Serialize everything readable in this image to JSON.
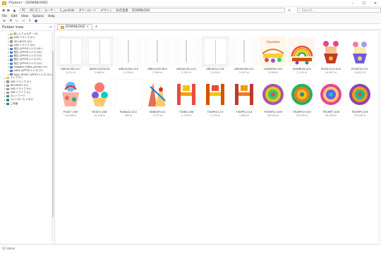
{
  "window": {
    "title": "XYplorer - [DOWNLOAD]",
    "buttons": [
      "–",
      "☐",
      "✕"
    ]
  },
  "address": {
    "segments": [
      "PC",
      "OS (C:)",
      "ユーザー",
      "k_yoshida",
      "ダウンロード",
      "デザイン",
      "虹色背景",
      "DOWNLOAD"
    ],
    "search_placeholder": "Search..."
  },
  "menu": [
    "File",
    "Edit",
    "View",
    "Options",
    "Help"
  ],
  "toolbar": {
    "icons": [
      "favorites-icon",
      "filter-icon",
      "back-icon",
      "forward-icon",
      "up-icon",
      "tag-icon"
    ]
  },
  "sidebar": {
    "header": "Folder tree",
    "items": [
      {
        "label": "新しいフォルダー (3)",
        "icon": "folder",
        "indent": 2
      },
      {
        "label": "USB ドライブ (E:)",
        "icon": "drive",
        "indent": 2
      },
      {
        "label": "HD-LBVU3 (G:)",
        "icon": "drive",
        "indent": 2
      },
      {
        "label": "USB ドライブ (H:)",
        "icon": "drive",
        "indent": 2
      },
      {
        "label": "他社 (\\\\PFX5-1.1-3) (M:)",
        "icon": "net",
        "indent": 2
      },
      {
        "label": "他社 (\\\\PFX5-1.1-3) (N:)",
        "icon": "net",
        "indent": 2
      },
      {
        "label": "他社 (\\\\PFX5-1.1-3) (O:)",
        "icon": "net",
        "indent": 2
      },
      {
        "label": "他社 (\\\\PFX5-1.1-3) (P:)",
        "icon": "net",
        "indent": 2
      },
      {
        "label": "他社 (\\\\PFX5-1.1-3) (Q:)",
        "icon": "net",
        "indent": 2
      },
      {
        "label": "Seagate (\\\\files_server) (S:)",
        "icon": "net",
        "indent": 2
      },
      {
        "label": "sdbiz (\\\\PFX5-1.1-3) (T:)",
        "icon": "net",
        "indent": 2
      },
      {
        "label": "Tools_RFIDS (\\\\PFX5-1.1-3) (U:)",
        "icon": "net",
        "indent": 2
      },
      {
        "label": "ライブラリ",
        "icon": "folder",
        "indent": 1
      },
      {
        "label": "USB ドライブ (E:)",
        "icon": "drive",
        "indent": 1
      },
      {
        "label": "HD-LBVU3 (G:)",
        "icon": "drive",
        "indent": 1
      },
      {
        "label": "USB ドライブ (H:)",
        "icon": "drive",
        "indent": 1
      },
      {
        "label": "USB ドライブ (J:)",
        "icon": "drive",
        "indent": 1
      },
      {
        "label": "ネットワーク",
        "icon": "net",
        "indent": 1
      },
      {
        "label": "コントロール パネル",
        "icon": "green",
        "indent": 1
      },
      {
        "label": "ごみ箱",
        "icon": "blue",
        "indent": 1
      }
    ]
  },
  "tabs": [
    {
      "label": "DOWNLOAD"
    }
  ],
  "files": [
    {
      "name": "AREA0300.U17",
      "size": "2,211 kl",
      "thumb": "blank"
    },
    {
      "name": "AREA12001018",
      "size": "2,080 kl",
      "thumb": "blank"
    },
    {
      "name": "AREA1000.U19",
      "size": "2,156 kl",
      "thumb": "vertical"
    },
    {
      "name": "AREA1000.B22",
      "size": "2,289 kl",
      "thumb": "vertical"
    },
    {
      "name": "AREA0100.U15",
      "size": "1,151 kl",
      "thumb": "vertical"
    },
    {
      "name": "AREA010.U16",
      "size": "1,105 kl",
      "thumb": "blank"
    },
    {
      "name": "AREA0000.U21",
      "size": "1,997 kl",
      "thumb": "vertical"
    },
    {
      "name": "GARDEN0.U01",
      "size": "5,096 kl",
      "thumb": "garden"
    },
    {
      "name": "RAINBOW.U02",
      "size": "2,120 kl",
      "thumb": "rainbow"
    },
    {
      "name": "ROSE1213.U10",
      "size": "14,992 kl",
      "thumb": "rose"
    },
    {
      "name": "ROSE3S.U11",
      "size": "14,821 kl",
      "thumb": "rose2"
    },
    {
      "name": "POSE7.U09",
      "size": "14,906 kl",
      "thumb": "pose"
    },
    {
      "name": "ROSE5.U08",
      "size": "14,418 kl",
      "thumb": "rose3"
    },
    {
      "name": "RUBAG2.U22",
      "size": "263 kl",
      "thumb": "blankwhite"
    },
    {
      "name": "3DBVDP.U12",
      "size": "1,573 kl",
      "thumb": "bvdp"
    },
    {
      "name": "T3DBS.U08",
      "size": "1,153 kl",
      "thumb": "h1"
    },
    {
      "name": "T3DPR3.U13",
      "size": "1,750 kl",
      "thumb": "h2"
    },
    {
      "name": "T3DPR2.U14",
      "size": "1,894 kl",
      "thumb": "h3"
    },
    {
      "name": "TRUMP12.U09",
      "size": "29,005 kl",
      "thumb": "trump1"
    },
    {
      "name": "TRUMP1H.U07",
      "size": "29,005 kl",
      "thumb": "trump2"
    },
    {
      "name": "TRUMP7.U08",
      "size": "29,005 kl",
      "thumb": "trump3"
    },
    {
      "name": "TRUMP5.U05",
      "size": "29,005 kl",
      "thumb": "trump4"
    }
  ],
  "status": {
    "text": "22 items"
  },
  "colors": {
    "accent": "#2e6fd0",
    "folder": "#f2c14e"
  }
}
